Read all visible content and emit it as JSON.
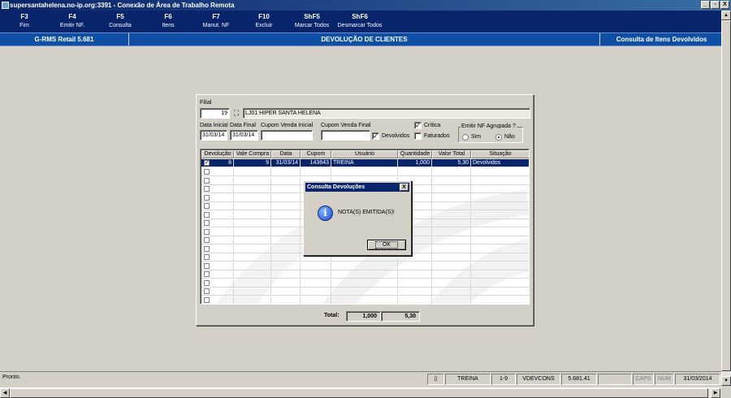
{
  "window": {
    "title": "supersantahelena.no-ip.org:3391 - Conexão de Área de Trabalho Remota",
    "controls": [
      "_",
      "▫",
      "X"
    ]
  },
  "fkeys": [
    {
      "key": "F3",
      "label": "Fim"
    },
    {
      "key": "F4",
      "label": "Emitir NF."
    },
    {
      "key": "F5",
      "label": "Consulta"
    },
    {
      "key": "F6",
      "label": "Itens"
    },
    {
      "key": "F7",
      "label": "Manut. NF"
    },
    {
      "key": "F10",
      "label": "Excluir"
    },
    {
      "key": "ShF5",
      "label": "Marcar Todos"
    },
    {
      "key": "ShF6",
      "label": "Desmarcar Todos"
    }
  ],
  "header": {
    "app": "G-RMS Retail 5.681",
    "screen": "DEVOLUÇÃO DE CLIENTES",
    "mode": "Consulta de Itens Devolvidos"
  },
  "form": {
    "filial_label": "Filial",
    "filial_code": "19",
    "filial_name": "LJ01 HIPER SANTA HELENA",
    "data_inicial_label": "Data Inicial",
    "data_inicial": "31/03/14",
    "data_final_label": "Data Final",
    "data_final": "31/03/14",
    "cupom_ini_label": "Cupom Venda Inicial",
    "cupom_ini": "",
    "cupom_fim_label": "Cupom Venda Final",
    "cupom_fim": "",
    "devolvidos_label": "Devolvidos",
    "critica_label": "Crítica",
    "faturados_label": "Faturados",
    "emitir_group_label": "Emitir NF Agrupada ?",
    "sim_label": "Sim",
    "nao_label": "Não"
  },
  "grid": {
    "columns": [
      "Devolução",
      "Vale Compra",
      "Data",
      "Cupom",
      "Usuário",
      "Quantidade",
      "Valor Total",
      "Situação"
    ],
    "rows": [
      {
        "checked": true,
        "devolucao": "8",
        "vale": "9",
        "data": "31/03/14",
        "cupom": "143643",
        "usuario": "TREINA",
        "quantidade": "1,000",
        "valor": "5,30",
        "situacao": "Devolvidos"
      }
    ],
    "empty_rows": 16
  },
  "totals": {
    "label": "Total:",
    "quantidade": "1,000",
    "valor": "5,30"
  },
  "dialog": {
    "title": "Consulta Devoluções",
    "close": "X",
    "message": "NOTA(S) EMITIDA(S)!",
    "ok": "OK",
    "icon": "info-icon"
  },
  "status": {
    "text": "Pronto.",
    "user": "TREINA",
    "range": "1-9",
    "program": "VDEVCONS",
    "version": "5.681.41",
    "caps": "CAPS",
    "num": "NUM",
    "date": "31/03/2014"
  },
  "colors": {
    "toolbar": "#08246b",
    "header": "#0e4fa5",
    "selection": "#0a246a",
    "face": "#d4d0c8"
  }
}
